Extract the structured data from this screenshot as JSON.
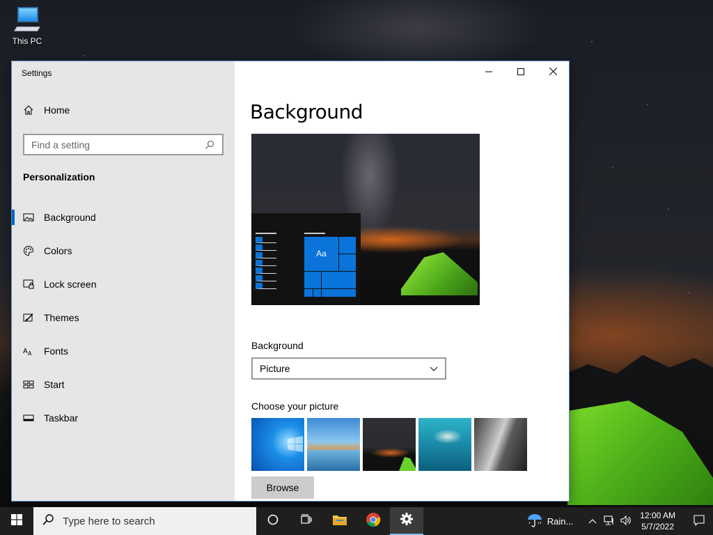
{
  "desktop": {
    "icon_label": "This PC"
  },
  "window": {
    "app_title": "Settings",
    "nav": {
      "home_label": "Home",
      "search_placeholder": "Find a setting",
      "section_title": "Personalization",
      "items": [
        {
          "label": "Background",
          "icon": "picture-icon",
          "active": true
        },
        {
          "label": "Colors",
          "icon": "palette-icon",
          "active": false
        },
        {
          "label": "Lock screen",
          "icon": "lock-screen-icon",
          "active": false
        },
        {
          "label": "Themes",
          "icon": "brush-icon",
          "active": false
        },
        {
          "label": "Fonts",
          "icon": "font-icon",
          "active": false
        },
        {
          "label": "Start",
          "icon": "start-icon",
          "active": false
        },
        {
          "label": "Taskbar",
          "icon": "taskbar-icon",
          "active": false
        }
      ]
    },
    "content": {
      "page_title": "Background",
      "preview_tile_text": "Aa",
      "background_label": "Background",
      "background_value": "Picture",
      "choose_label": "Choose your picture",
      "browse_label": "Browse"
    }
  },
  "taskbar": {
    "search_placeholder": "Type here to search",
    "weather_text": "Rain...",
    "time": "12:00 AM",
    "date": "5/7/2022"
  },
  "colors": {
    "accent": "#0067c0",
    "nav_bg": "#e6e6e6",
    "taskbar_bg": "#1f1f1f"
  }
}
